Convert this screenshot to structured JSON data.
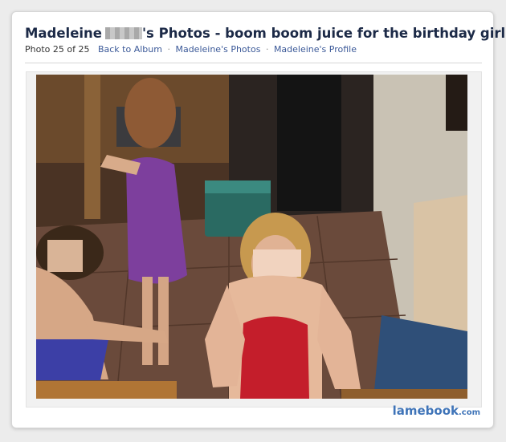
{
  "header": {
    "title_owner": "Madeleine",
    "title_suffix": "'s Photos - boom boom juice for the birthday girl."
  },
  "nav": {
    "photo_counter": "Photo 25 of 25",
    "back_to_album": "Back to Album",
    "owner_photos": "Madeleine's Photos",
    "owner_profile": "Madeleine's Profile",
    "separator": "·"
  },
  "watermark": {
    "brand": "lamebook",
    "suffix": ".com"
  },
  "colors": {
    "link": "#3b5998",
    "title": "#1c2a47",
    "watermark": "#3f74b8"
  }
}
